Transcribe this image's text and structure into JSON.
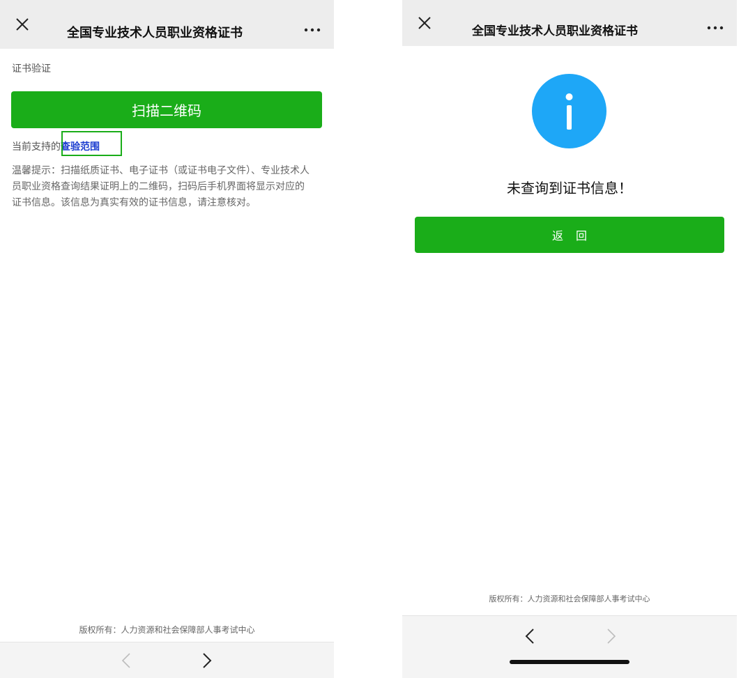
{
  "left_screen": {
    "nav": {
      "close_icon": "close-icon",
      "title": "全国专业技术人员职业资格证书",
      "more_icon": "more-icon"
    },
    "page_heading": "证书验证",
    "scan_button": "扫描二维码",
    "support_prefix": "当前支持的",
    "support_link": "查验范围",
    "tip": "温馨提示：扫描纸质证书、电子证书（或证书电子文件）、专业技术人员职业资格查询结果证明上的二维码，扫码后手机界面将显示对应的证书信息。该信息为真实有效的证书信息，请注意核对。",
    "footer": "版权所有：人力资源和社会保障部人事考试中心",
    "bottom_nav": {
      "back_icon": "chevron-left-icon",
      "forward_icon": "chevron-right-icon"
    }
  },
  "right_screen": {
    "nav": {
      "close_icon": "close-icon",
      "title": "全国专业技术人员职业资格证书",
      "more_icon": "more-icon"
    },
    "status_icon": "info-icon",
    "message": "未查询到证书信息！",
    "back_button": "返回",
    "footer": "版权所有：人力资源和社会保障部人事考试中心",
    "bottom_nav": {
      "back_icon": "chevron-left-icon",
      "forward_icon": "chevron-right-icon"
    }
  },
  "colors": {
    "primary_green": "#1aad19",
    "link_blue": "#1a3ccf",
    "info_blue": "#1ea7f7",
    "nav_bar_bg": "#ededed"
  }
}
